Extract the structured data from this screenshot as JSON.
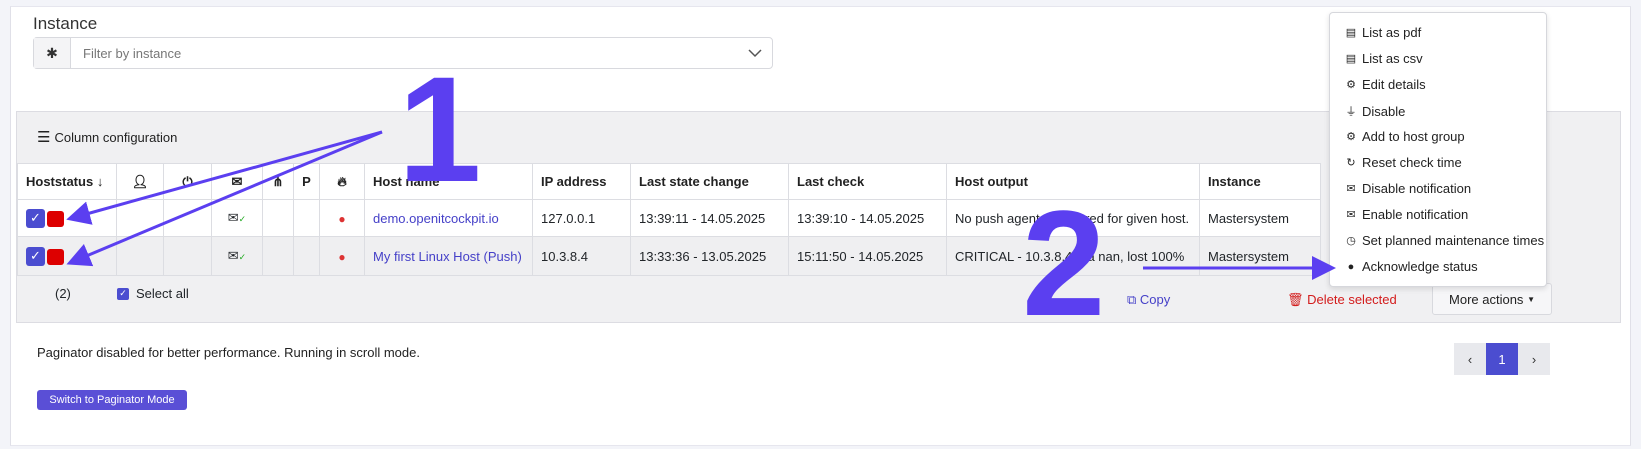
{
  "instance_section": {
    "title": "Instance",
    "filter_placeholder": "Filter by instance"
  },
  "toolbar": {
    "column_config_label": "Column configuration"
  },
  "table": {
    "headers": {
      "hoststatus": "Hoststatus",
      "p": "P",
      "host_name": "Host name",
      "ip": "IP address",
      "last_state_change": "Last state change",
      "last_check": "Last check",
      "host_output": "Host output",
      "instance": "Instance"
    },
    "rows": [
      {
        "host_name": "demo.openitcockpit.io",
        "ip": "127.0.0.1",
        "last_state_change": "13:39:11 - 14.05.2025",
        "last_check": "13:39:10 - 14.05.2025",
        "host_output": "No push agent configured for given host.",
        "instance": "Mastersystem"
      },
      {
        "host_name": "My first Linux Host (Push)",
        "ip": "10.3.8.4",
        "last_state_change": "13:33:36 - 13.05.2025",
        "last_check": "15:11:50 - 14.05.2025",
        "host_output": "CRITICAL - 10.3.8.4: rta nan, lost 100%",
        "instance": "Mastersystem"
      }
    ]
  },
  "footer": {
    "selected_count": "(2)",
    "select_all": "Select all",
    "copy": "Copy",
    "delete_selected": "Delete selected",
    "more_actions": "More actions"
  },
  "dropdown": {
    "items": [
      {
        "label": "List as pdf",
        "icon": "file-pdf-icon"
      },
      {
        "label": "List as csv",
        "icon": "file-csv-icon"
      },
      {
        "label": "Edit details",
        "icon": "cogs-icon"
      },
      {
        "label": "Disable",
        "icon": "plug-icon"
      },
      {
        "label": "Add to host group",
        "icon": "cogs-icon"
      },
      {
        "label": "Reset check time",
        "icon": "refresh-icon"
      },
      {
        "label": "Disable notification",
        "icon": "envelope-icon"
      },
      {
        "label": "Enable notification",
        "icon": "envelope-icon"
      },
      {
        "label": "Set planned maintenance times",
        "icon": "clock-icon"
      },
      {
        "label": "Acknowledge status",
        "icon": "user-icon"
      }
    ]
  },
  "paginator": {
    "message": "Paginator disabled for better performance. Running in scroll mode.",
    "switch_button": "Switch to Paginator Mode",
    "current_page": "1"
  },
  "annotations": {
    "marker_1": "1",
    "marker_2": "2",
    "color": "#5b3ff0"
  }
}
